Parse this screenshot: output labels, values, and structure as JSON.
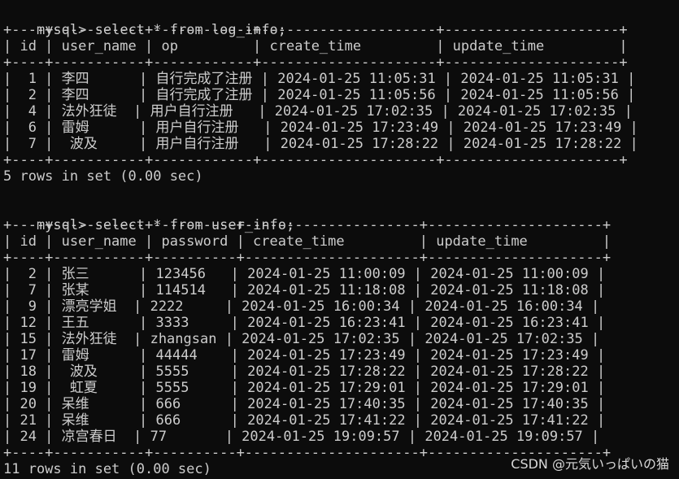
{
  "queries": [
    {
      "prompt": "mysql>",
      "command": "select * from log_info;",
      "border": "+----+-----------+------------+---------------------+---------------------+",
      "header": "| id | user_name | op         | create_time         | update_time         |",
      "rows": [
        "|  1 | 李四      | 自行完成了注册 | 2024-01-25 11:05:31 | 2024-01-25 11:05:31 |",
        "|  2 | 李四      | 自行完成了注册 | 2024-01-25 11:05:56 | 2024-01-25 11:05:56 |",
        "|  4 | 法外狂徒  | 用户自行注册   | 2024-01-25 17:02:35 | 2024-01-25 17:02:35 |",
        "|  6 | 雷姆      | 用户自行注册   | 2024-01-25 17:23:49 | 2024-01-25 17:23:49 |",
        "|  7 |  波及     | 用户自行注册   | 2024-01-25 17:28:22 | 2024-01-25 17:28:22 |"
      ],
      "summary": "5 rows in set (0.00 sec)"
    },
    {
      "prompt": "mysql>",
      "command": "select * from user_info;",
      "border": "+----+-----------+----------+---------------------+---------------------+",
      "header": "| id | user_name | password | create_time         | update_time         |",
      "rows": [
        "|  2 | 张三      | 123456   | 2024-01-25 11:00:09 | 2024-01-25 11:00:09 |",
        "|  7 | 张某      | 114514   | 2024-01-25 11:18:08 | 2024-01-25 11:18:08 |",
        "|  9 | 漂亮学姐  | 2222     | 2024-01-25 16:00:34 | 2024-01-25 16:00:34 |",
        "| 12 | 王五      | 3333     | 2024-01-25 16:23:41 | 2024-01-25 16:23:41 |",
        "| 15 | 法外狂徒  | zhangsan | 2024-01-25 17:02:35 | 2024-01-25 17:02:35 |",
        "| 17 | 雷姆      | 44444    | 2024-01-25 17:23:49 | 2024-01-25 17:23:49 |",
        "| 18 |  波及     | 5555     | 2024-01-25 17:28:22 | 2024-01-25 17:28:22 |",
        "| 19 |  虹夏     | 5555     | 2024-01-25 17:29:01 | 2024-01-25 17:29:01 |",
        "| 20 | 呆维      | 666      | 2024-01-25 17:40:35 | 2024-01-25 17:40:35 |",
        "| 21 | 呆维      | 666      | 2024-01-25 17:41:22 | 2024-01-25 17:41:22 |",
        "| 24 | 凉宫春日  | 77       | 2024-01-25 19:09:57 | 2024-01-25 19:09:57 |"
      ],
      "summary": "11 rows in set (0.00 sec)"
    }
  ],
  "watermark": "CSDN @元気いっぱいの猫"
}
